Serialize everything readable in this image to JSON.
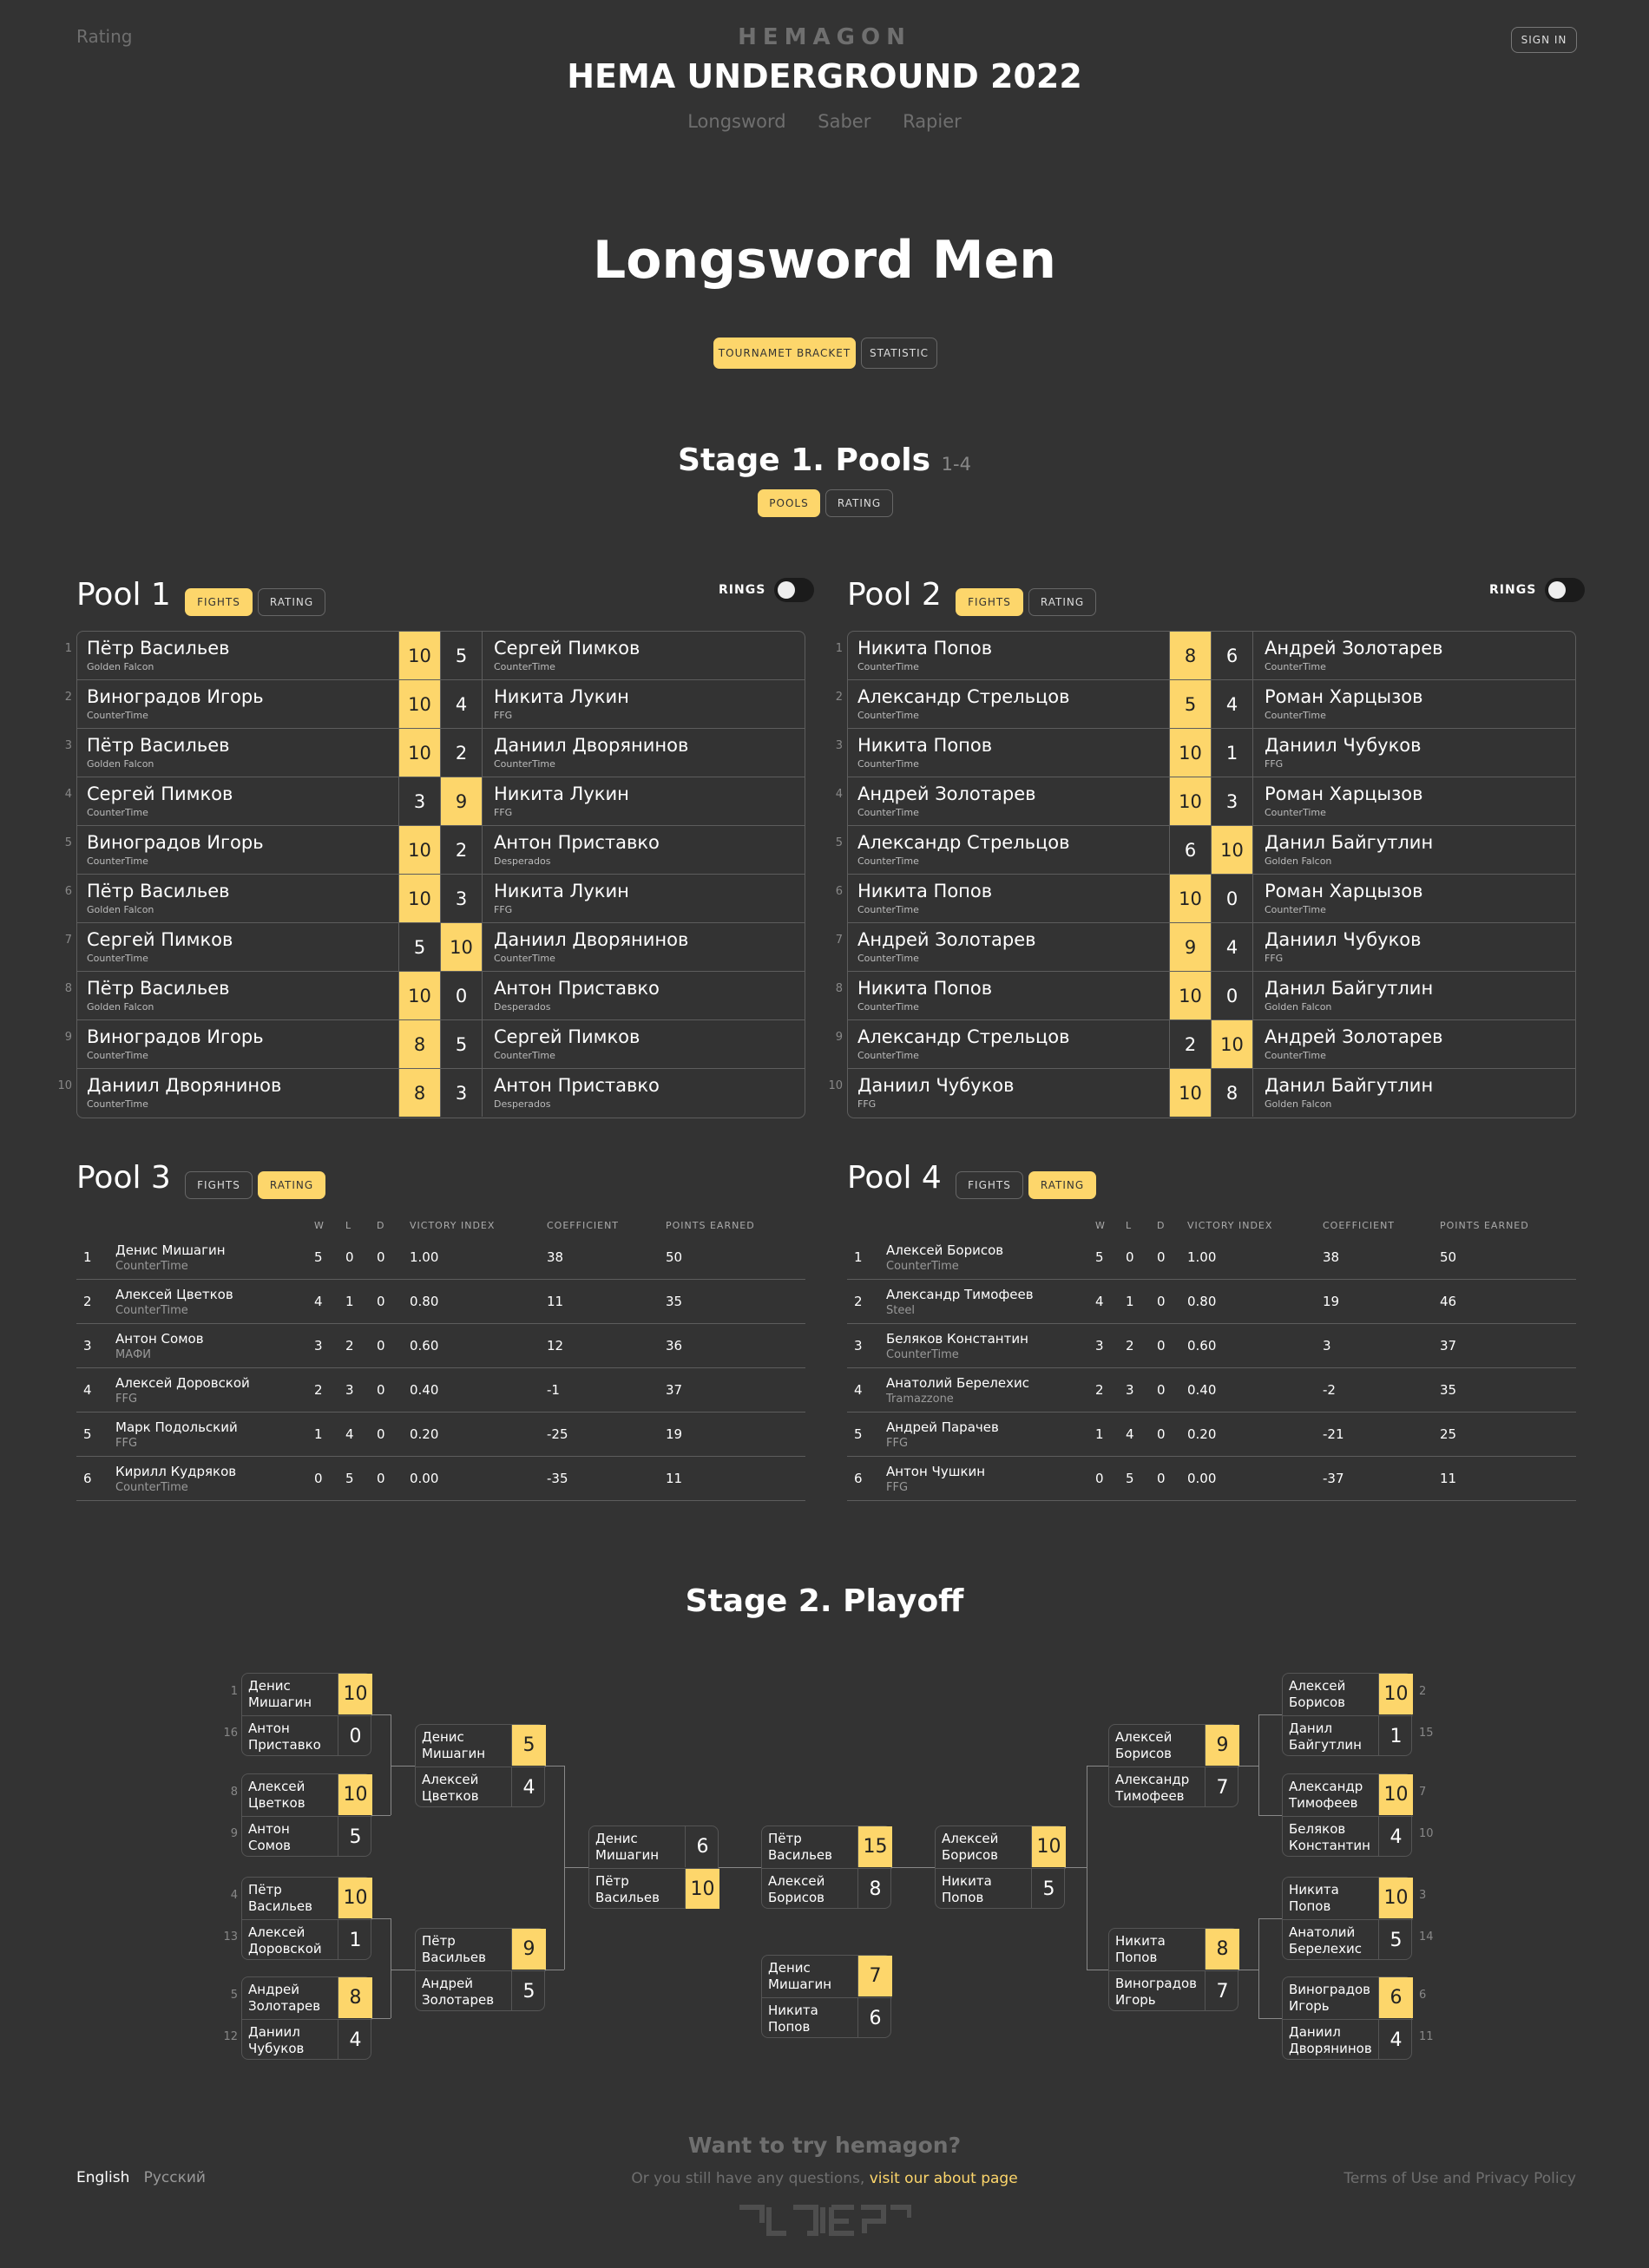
{
  "header": {
    "rating_link": "Rating",
    "logo": "HEMAGON",
    "event": "HEMA UNDERGROUND 2022",
    "weapons": [
      "Longsword",
      "Saber",
      "Rapier"
    ],
    "sign_in": "SIGN IN"
  },
  "page": {
    "title": "Longsword Men",
    "tabs": {
      "bracket": "TOURNAMET BRACKET",
      "statistic": "STATISTIC"
    }
  },
  "stage1": {
    "title": "Stage 1. Pools",
    "range": "1-4",
    "tabs": {
      "pools": "POOLS",
      "rating": "RATING"
    }
  },
  "labels": {
    "fights": "FIGHTS",
    "rating": "RATING",
    "rings": "RINGS",
    "w": "W",
    "l": "L",
    "d": "D",
    "victory_index": "VICTORY INDEX",
    "coefficient": "COEFFICIENT",
    "points_earned": "POINTS EARNED"
  },
  "pools": [
    {
      "title": "Pool 1",
      "fights": [
        [
          "Пётр Васильев",
          "Golden Falcon",
          "10",
          "5",
          "Сергей Пимков",
          "CounterTime",
          "l"
        ],
        [
          "Виноградов Игорь",
          "CounterTime",
          "10",
          "4",
          "Никита Лукин",
          "FFG",
          "l"
        ],
        [
          "Пётр Васильев",
          "Golden Falcon",
          "10",
          "2",
          "Даниил Дворянинов",
          "CounterTime",
          "l"
        ],
        [
          "Сергей Пимков",
          "CounterTime",
          "3",
          "9",
          "Никита Лукин",
          "FFG",
          "r"
        ],
        [
          "Виноградов Игорь",
          "CounterTime",
          "10",
          "2",
          "Антон Приставко",
          "Desperados",
          "l"
        ],
        [
          "Пётр Васильев",
          "Golden Falcon",
          "10",
          "3",
          "Никита Лукин",
          "FFG",
          "l"
        ],
        [
          "Сергей Пимков",
          "CounterTime",
          "5",
          "10",
          "Даниил Дворянинов",
          "CounterTime",
          "r"
        ],
        [
          "Пётр Васильев",
          "Golden Falcon",
          "10",
          "0",
          "Антон Приставко",
          "Desperados",
          "l"
        ],
        [
          "Виноградов Игорь",
          "CounterTime",
          "8",
          "5",
          "Сергей Пимков",
          "CounterTime",
          "l"
        ],
        [
          "Даниил Дворянинов",
          "CounterTime",
          "8",
          "3",
          "Антон Приставко",
          "Desperados",
          "l"
        ]
      ]
    },
    {
      "title": "Pool 2",
      "fights": [
        [
          "Никита Попов",
          "CounterTime",
          "8",
          "6",
          "Андрей Золотарев",
          "CounterTime",
          "l"
        ],
        [
          "Александр Стрельцов",
          "CounterTime",
          "5",
          "4",
          "Роман Харцызов",
          "CounterTime",
          "l"
        ],
        [
          "Никита Попов",
          "CounterTime",
          "10",
          "1",
          "Даниил Чубуков",
          "FFG",
          "l"
        ],
        [
          "Андрей Золотарев",
          "CounterTime",
          "10",
          "3",
          "Роман Харцызов",
          "CounterTime",
          "l"
        ],
        [
          "Александр Стрельцов",
          "CounterTime",
          "6",
          "10",
          "Данил Байгутлин",
          "Golden Falcon",
          "r"
        ],
        [
          "Никита Попов",
          "CounterTime",
          "10",
          "0",
          "Роман Харцызов",
          "CounterTime",
          "l"
        ],
        [
          "Андрей Золотарев",
          "CounterTime",
          "9",
          "4",
          "Даниил Чубуков",
          "FFG",
          "l"
        ],
        [
          "Никита Попов",
          "CounterTime",
          "10",
          "0",
          "Данил Байгутлин",
          "Golden Falcon",
          "l"
        ],
        [
          "Александр Стрельцов",
          "CounterTime",
          "2",
          "10",
          "Андрей Золотарев",
          "CounterTime",
          "r"
        ],
        [
          "Даниил Чубуков",
          "FFG",
          "10",
          "8",
          "Данил Байгутлин",
          "Golden Falcon",
          "l"
        ]
      ]
    },
    {
      "title": "Pool 3",
      "rating": [
        [
          "1",
          "Денис Мишагин",
          "CounterTime",
          "5",
          "0",
          "0",
          "1.00",
          "38",
          "50"
        ],
        [
          "2",
          "Алексей Цветков",
          "CounterTime",
          "4",
          "1",
          "0",
          "0.80",
          "11",
          "35"
        ],
        [
          "3",
          "Антон Сомов",
          "МАФИ",
          "3",
          "2",
          "0",
          "0.60",
          "12",
          "36"
        ],
        [
          "4",
          "Алексей Доровской",
          "FFG",
          "2",
          "3",
          "0",
          "0.40",
          "-1",
          "37"
        ],
        [
          "5",
          "Марк Подольский",
          "FFG",
          "1",
          "4",
          "0",
          "0.20",
          "-25",
          "19"
        ],
        [
          "6",
          "Кирилл Кудряков",
          "CounterTime",
          "0",
          "5",
          "0",
          "0.00",
          "-35",
          "11"
        ]
      ]
    },
    {
      "title": "Pool 4",
      "rating": [
        [
          "1",
          "Алексей Борисов",
          "CounterTime",
          "5",
          "0",
          "0",
          "1.00",
          "38",
          "50"
        ],
        [
          "2",
          "Александр Тимофеев",
          "Steel",
          "4",
          "1",
          "0",
          "0.80",
          "19",
          "46"
        ],
        [
          "3",
          "Беляков Константин",
          "CounterTime",
          "3",
          "2",
          "0",
          "0.60",
          "3",
          "37"
        ],
        [
          "4",
          "Анатолий Берелехис",
          "Tramazzone",
          "2",
          "3",
          "0",
          "0.40",
          "-2",
          "35"
        ],
        [
          "5",
          "Андрей Парачев",
          "FFG",
          "1",
          "4",
          "0",
          "0.20",
          "-21",
          "25"
        ],
        [
          "6",
          "Антон Чушкин",
          "FFG",
          "0",
          "5",
          "0",
          "0.00",
          "-37",
          "11"
        ]
      ]
    }
  ],
  "stage2": {
    "title": "Stage 2. Playoff"
  },
  "bracket": [
    {
      "a": "Денис Мишагин",
      "as": "10",
      "b": "Антон Приставко",
      "bs": "0",
      "w": "a",
      "sa": "1",
      "sb": "16"
    },
    {
      "a": "Алексей Цветков",
      "as": "10",
      "b": "Антон Сомов",
      "bs": "5",
      "w": "a",
      "sa": "8",
      "sb": "9"
    },
    {
      "a": "Пётр Васильев",
      "as": "10",
      "b": "Алексей Доровской",
      "bs": "1",
      "w": "a",
      "sa": "4",
      "sb": "13"
    },
    {
      "a": "Андрей Золотарев",
      "as": "8",
      "b": "Даниил Чубуков",
      "bs": "4",
      "w": "a",
      "sa": "5",
      "sb": "12"
    },
    {
      "a": "Денис Мишагин",
      "as": "5",
      "b": "Алексей Цветков",
      "bs": "4",
      "w": "a"
    },
    {
      "a": "Пётр Васильев",
      "as": "9",
      "b": "Андрей Золотарев",
      "bs": "5",
      "w": "a"
    },
    {
      "a": "Денис Мишагин",
      "as": "6",
      "b": "Пётр Васильев",
      "bs": "10",
      "w": "b"
    },
    {
      "a": "Пётр Васильев",
      "as": "15",
      "b": "Алексей Борисов",
      "bs": "8",
      "w": "a"
    },
    {
      "a": "Денис Мишагин",
      "as": "7",
      "b": "Никита Попов",
      "bs": "6",
      "w": "a"
    },
    {
      "a": "Алексей Борисов",
      "as": "10",
      "b": "Никита Попов",
      "bs": "5",
      "w": "a"
    },
    {
      "a": "Алексей Борисов",
      "as": "9",
      "b": "Александр Тимофеев",
      "bs": "7",
      "w": "a"
    },
    {
      "a": "Никита Попов",
      "as": "8",
      "b": "Виноградов Игорь",
      "bs": "7",
      "w": "a"
    },
    {
      "a": "Алексей Борисов",
      "as": "10",
      "b": "Данил Байгутлин",
      "bs": "1",
      "w": "a",
      "sa": "2",
      "sb": "15"
    },
    {
      "a": "Александр Тимофеев",
      "as": "10",
      "b": "Беляков Константин",
      "bs": "4",
      "w": "a",
      "sa": "7",
      "sb": "10"
    },
    {
      "a": "Никита Попов",
      "as": "10",
      "b": "Анатолий Берелехис",
      "bs": "5",
      "w": "a",
      "sa": "3",
      "sb": "14"
    },
    {
      "a": "Виноградов Игорь",
      "as": "6",
      "b": "Даниил Дворянинов",
      "bs": "4",
      "w": "a",
      "sa": "6",
      "sb": "11"
    }
  ],
  "footer": {
    "lang_en": "English",
    "lang_ru": "Русский",
    "cta": "Want to try hemagon?",
    "question": "Or you still have any questions,",
    "about_link": "visit our about page",
    "terms": "Terms of Use and Privacy Policy"
  },
  "colors": {
    "accent": "#fdd66b",
    "background": "#333333"
  }
}
